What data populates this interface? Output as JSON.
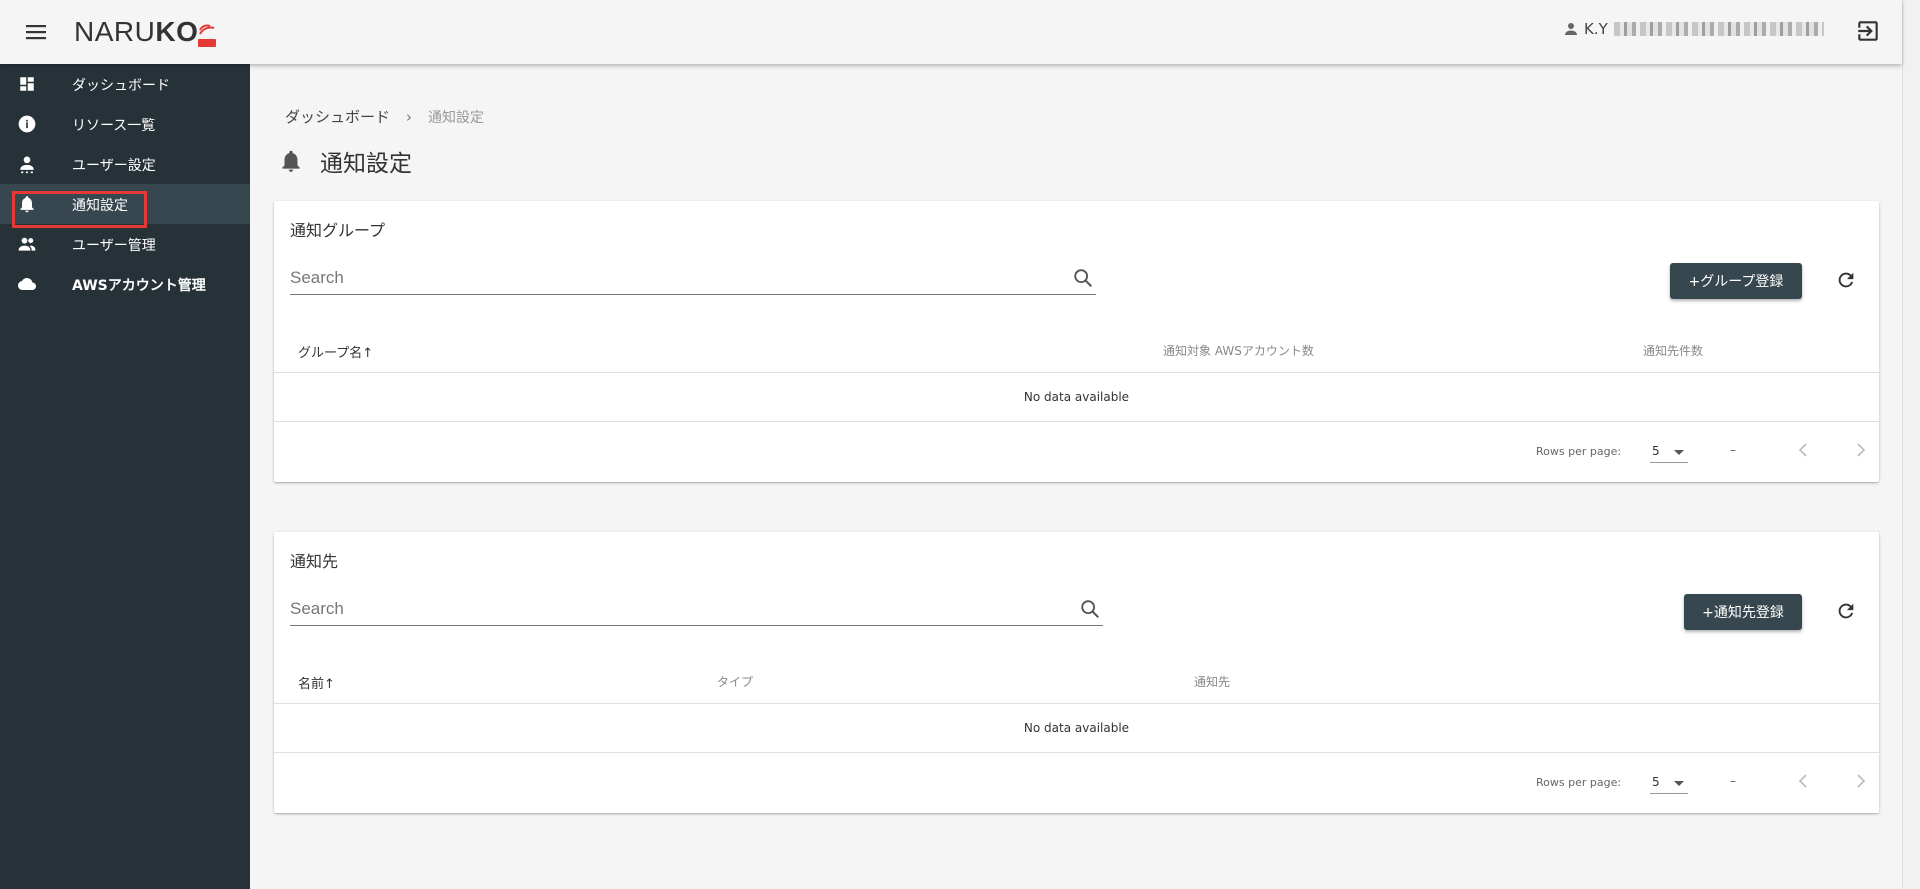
{
  "header": {
    "logo_text_regular": "NARU",
    "logo_text_bold": "KO",
    "user_name": "K.Y"
  },
  "sidebar": {
    "items": [
      {
        "label": "ダッシュボード",
        "icon": "dashboard-icon"
      },
      {
        "label": "リソース一覧",
        "icon": "info-icon"
      },
      {
        "label": "ユーザー設定",
        "icon": "person-icon"
      },
      {
        "label": "通知設定",
        "icon": "bell-icon",
        "active": true
      },
      {
        "label": "ユーザー管理",
        "icon": "people-icon"
      },
      {
        "label": "AWSアカウント管理",
        "icon": "cloud-icon"
      }
    ]
  },
  "breadcrumb": {
    "home": "ダッシュボード",
    "separator": "›",
    "current": "通知設定"
  },
  "page": {
    "title": "通知設定"
  },
  "groups_card": {
    "title": "通知グループ",
    "search_placeholder": "Search",
    "add_button": "+グループ登録",
    "columns": [
      "グループ名",
      "通知対象 AWSアカウント数",
      "通知先件数"
    ],
    "sort_arrow": "↑",
    "empty_text": "No data available",
    "rows_per_page_label": "Rows per page:",
    "rows_per_page_value": "5",
    "range_text": "–"
  },
  "destinations_card": {
    "title": "通知先",
    "search_placeholder": "Search",
    "add_button": "+通知先登録",
    "columns": [
      "名前",
      "タイプ",
      "通知先"
    ],
    "sort_arrow": "↑",
    "empty_text": "No data available",
    "rows_per_page_label": "Rows per page:",
    "rows_per_page_value": "5",
    "range_text": "–"
  },
  "colors": {
    "sidebar_bg": "#263238",
    "sidebar_active": "#37474f",
    "button_bg": "#37474f",
    "highlight": "#e53935",
    "logo_accent": "#e53935"
  }
}
